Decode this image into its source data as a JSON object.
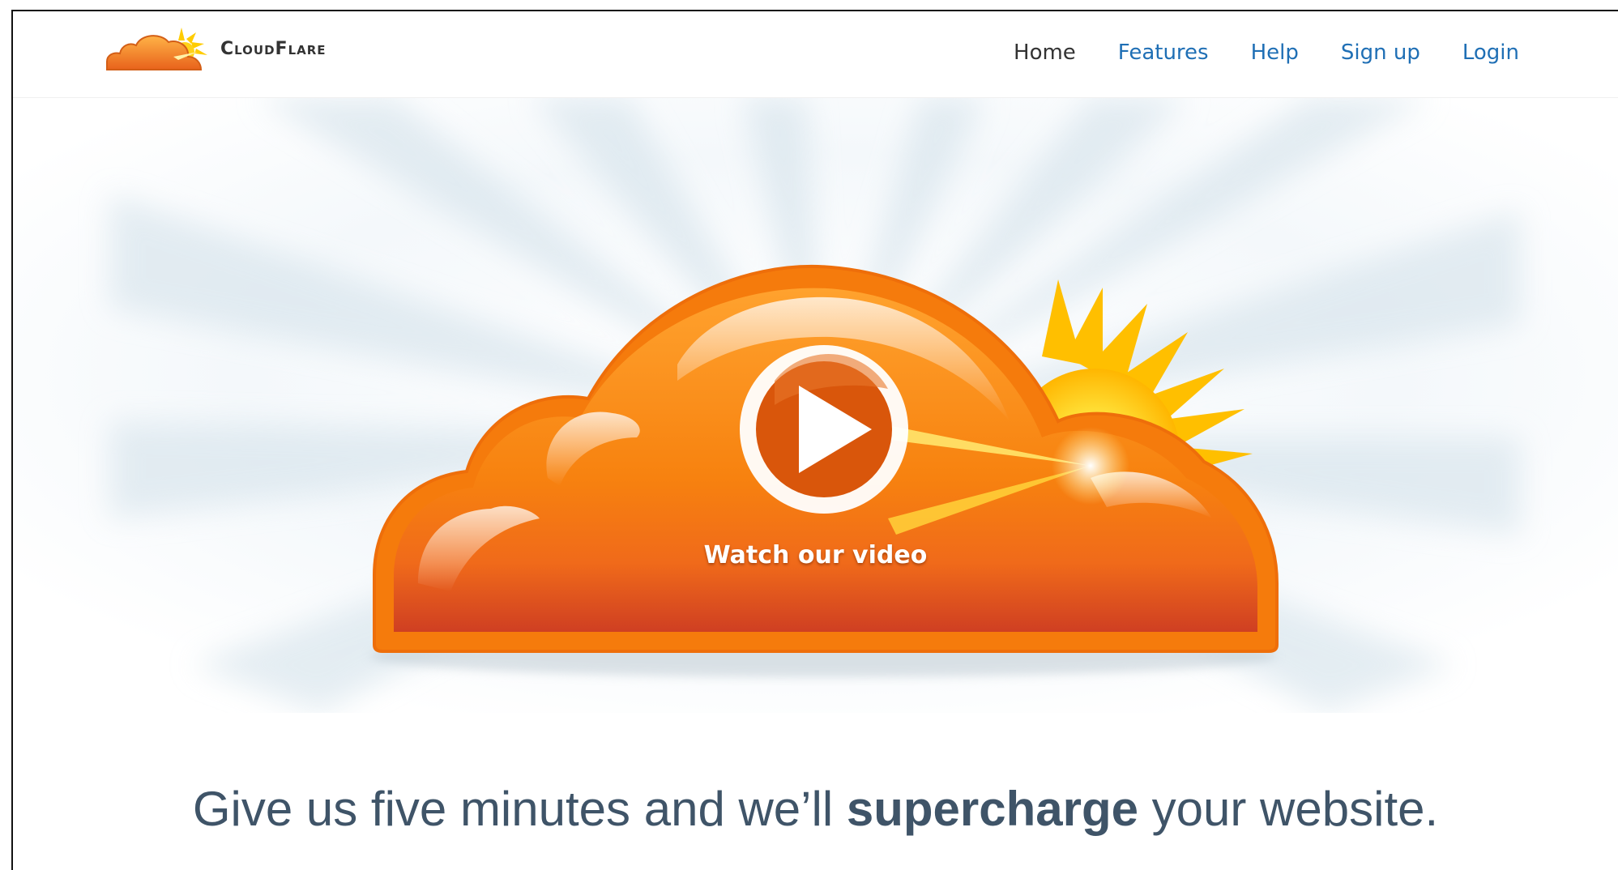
{
  "brand": {
    "name": "CloudFlare"
  },
  "nav": {
    "items": [
      {
        "label": "Home",
        "active": true
      },
      {
        "label": "Features",
        "active": false
      },
      {
        "label": "Help",
        "active": false
      },
      {
        "label": "Sign up",
        "active": false
      },
      {
        "label": "Login",
        "active": false
      }
    ]
  },
  "hero": {
    "video_label": "Watch our video"
  },
  "tagline": {
    "before": "Give us five minutes and we’ll ",
    "emphasis": "supercharge",
    "after": " your website."
  },
  "colors": {
    "link": "#1f6fb5",
    "nav_active": "#333333",
    "cloud": "#f7820f",
    "cloud_dark": "#d5461f",
    "sun": "#ffd21a",
    "tagline": "#3f5468"
  },
  "icons": {
    "logo": "cloud-sun-logo-icon",
    "play": "play-icon"
  }
}
